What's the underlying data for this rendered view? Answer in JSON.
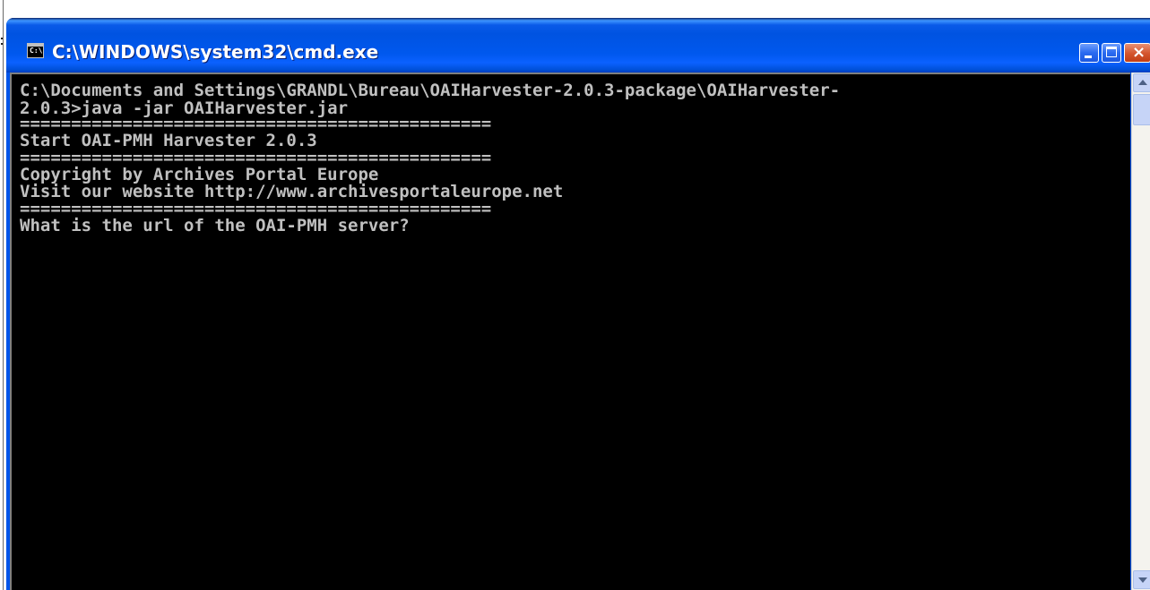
{
  "window": {
    "title": "C:\\WINDOWS\\system32\\cmd.exe",
    "icon": "cmd-console-icon",
    "icon_glyph": "C:\\",
    "controls": {
      "minimize_icon": "minimize-icon",
      "maximize_icon": "maximize-icon",
      "close_icon": "close-icon",
      "close_glyph": "×"
    }
  },
  "console": {
    "colors": {
      "background": "#000000",
      "text": "#c0c0c0"
    },
    "lines": [
      "C:\\Documents and Settings\\GRANDL\\Bureau\\OAIHarvester-2.0.3-package\\OAIHarvester-",
      "2.0.3>java -jar OAIHarvester.jar",
      "==============================================",
      "Start OAI-PMH Harvester 2.0.3",
      "==============================================",
      "Copyright by Archives Portal Europe",
      "Visit our website http://www.archivesportaleurope.net",
      "==============================================",
      "What is the url of the OAI-PMH server?"
    ]
  },
  "scrollbar": {
    "up_icon": "scroll-up-arrow-icon",
    "down_icon": "scroll-down-arrow-icon"
  },
  "colors": {
    "titlebar": "#0054e3",
    "close_button": "#d3542c",
    "scrollbar_track": "#f4f3ee"
  }
}
